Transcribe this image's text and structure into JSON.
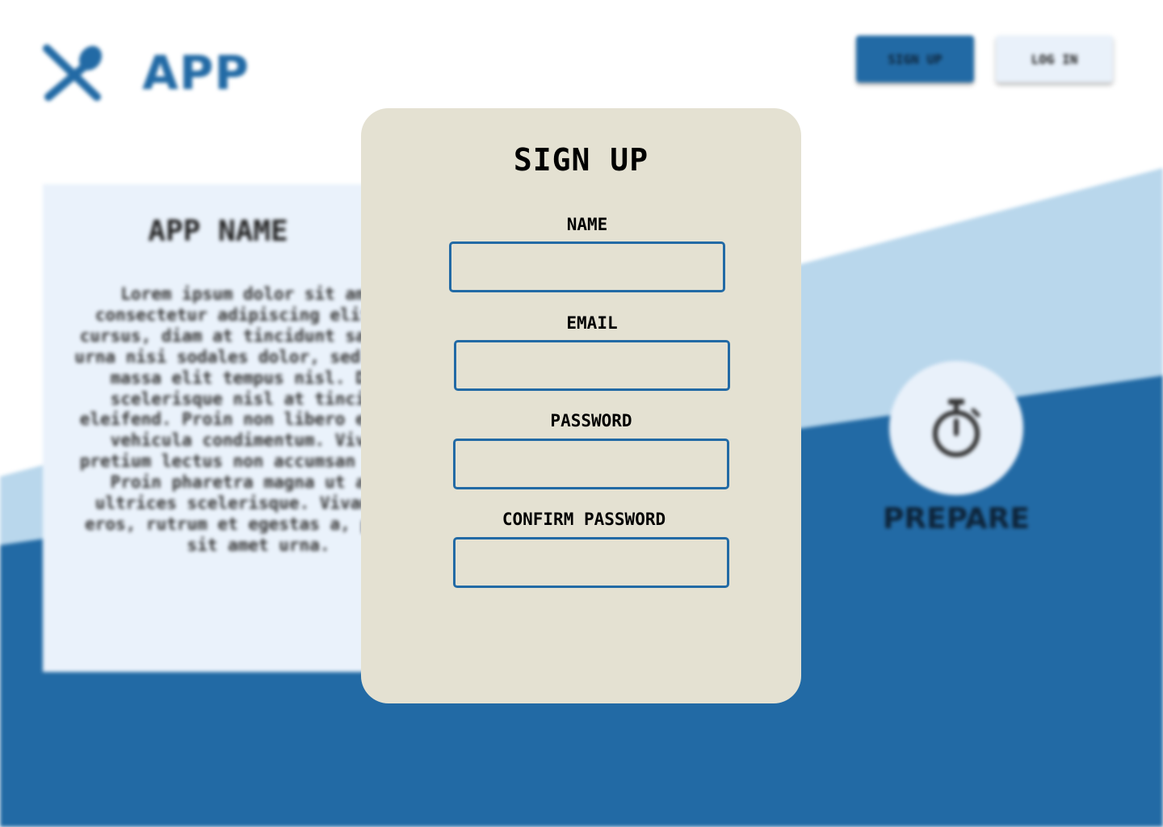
{
  "header": {
    "app_title": "APP",
    "signup_label": "SIGN UP",
    "login_label": "LOG IN"
  },
  "info_card": {
    "title": "APP NAME",
    "body": "Lorem ipsum dolor sit amet, consectetur adipiscing elit. Nam cursus, diam at tincidunt sagittis, urna nisi sodales dolor, sed iaculis massa elit tempus nisl. Donec scelerisque nisl at tincidunt eleifend. Proin non libero et lacus vehicula condimentum. Vivamus pretium lectus non accumsan auctor. Proin pharetra magna ut augue ultrices scelerisque. Vivamus et eros, rutrum et egestas a, posuere sit amet urna."
  },
  "feature": {
    "icon": "stopwatch-icon",
    "label": "PREPARE"
  },
  "modal": {
    "title": "SIGN UP",
    "fields": [
      {
        "label": "NAME",
        "value": "",
        "placeholder": ""
      },
      {
        "label": "EMAIL",
        "value": "",
        "placeholder": ""
      },
      {
        "label": "PASSWORD",
        "value": "",
        "placeholder": ""
      },
      {
        "label": "CONFIRM PASSWORD",
        "value": "",
        "placeholder": ""
      }
    ]
  },
  "colors": {
    "brand_blue": "#226aa5",
    "light_blue": "#b9d7ec",
    "modal_bg": "#e4e1d2",
    "card_bg": "#eaf2fb"
  }
}
